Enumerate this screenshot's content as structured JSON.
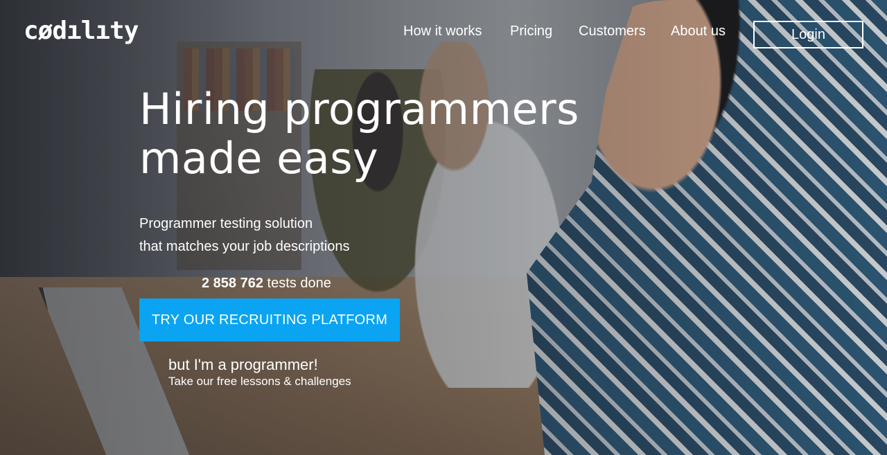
{
  "header": {
    "logo_text": "cødılıty",
    "nav": [
      {
        "label": "How it works"
      },
      {
        "label": "Pricing"
      },
      {
        "label": "Customers"
      },
      {
        "label": "About us"
      }
    ],
    "login_label": "Login"
  },
  "hero": {
    "headline_line1": "Hiring programmers",
    "headline_line2": "made easy",
    "subline_line1": "Programmer testing solution",
    "subline_line2": "that matches your job descriptions",
    "tests_count": "2 858 762",
    "tests_label": "tests done",
    "cta_label": "TRY OUR RECRUITING PLATFORM",
    "programmer_title": "but I'm a programmer!",
    "programmer_sub": "Take our free lessons & challenges"
  },
  "colors": {
    "cta_blue": "#0aa4f2",
    "text": "#ffffff"
  }
}
